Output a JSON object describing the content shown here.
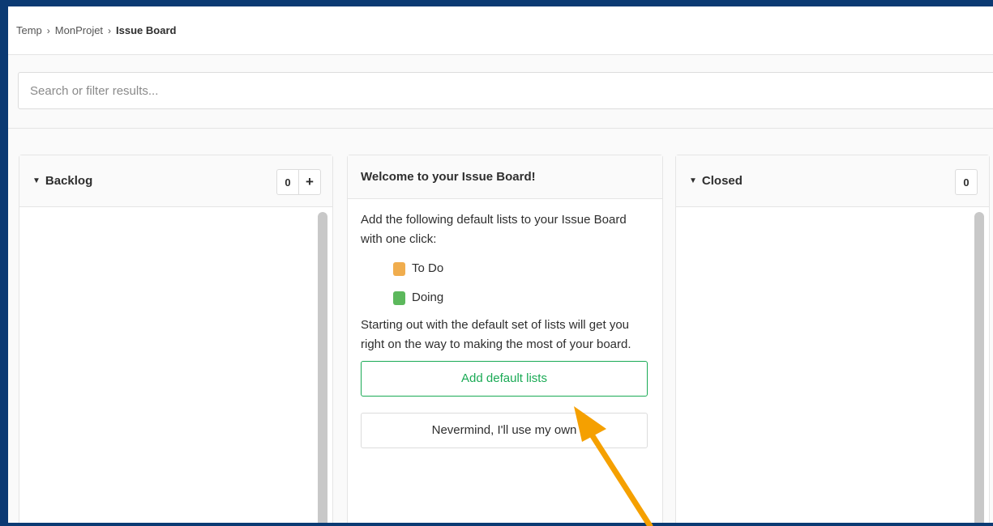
{
  "breadcrumb": {
    "items": [
      "Temp",
      "MonProjet",
      "Issue Board"
    ],
    "separator": "›"
  },
  "search": {
    "placeholder": "Search or filter results..."
  },
  "lists": {
    "backlog": {
      "title": "Backlog",
      "count": "0",
      "add_label": "+"
    },
    "closed": {
      "title": "Closed",
      "count": "0"
    }
  },
  "welcome": {
    "title": "Welcome to your Issue Board!",
    "intro": "Add the following default lists to your Issue Board with one click:",
    "labels": [
      {
        "name": "To Do",
        "color": "#f0ad4e"
      },
      {
        "name": "Doing",
        "color": "#5cb85c"
      }
    ],
    "description": "Starting out with the default set of lists will get you right on the way to making the most of your board.",
    "add_button": "Add default lists",
    "dismiss_button": "Nevermind, I'll use my own"
  },
  "colors": {
    "accent_green": "#1aaa55",
    "annotation_arrow": "#f5a000",
    "outer_background": "#0b3a73"
  },
  "icons": {
    "caret": "caret-down-icon",
    "separator": "chevron-right-icon",
    "add": "plus-icon"
  }
}
